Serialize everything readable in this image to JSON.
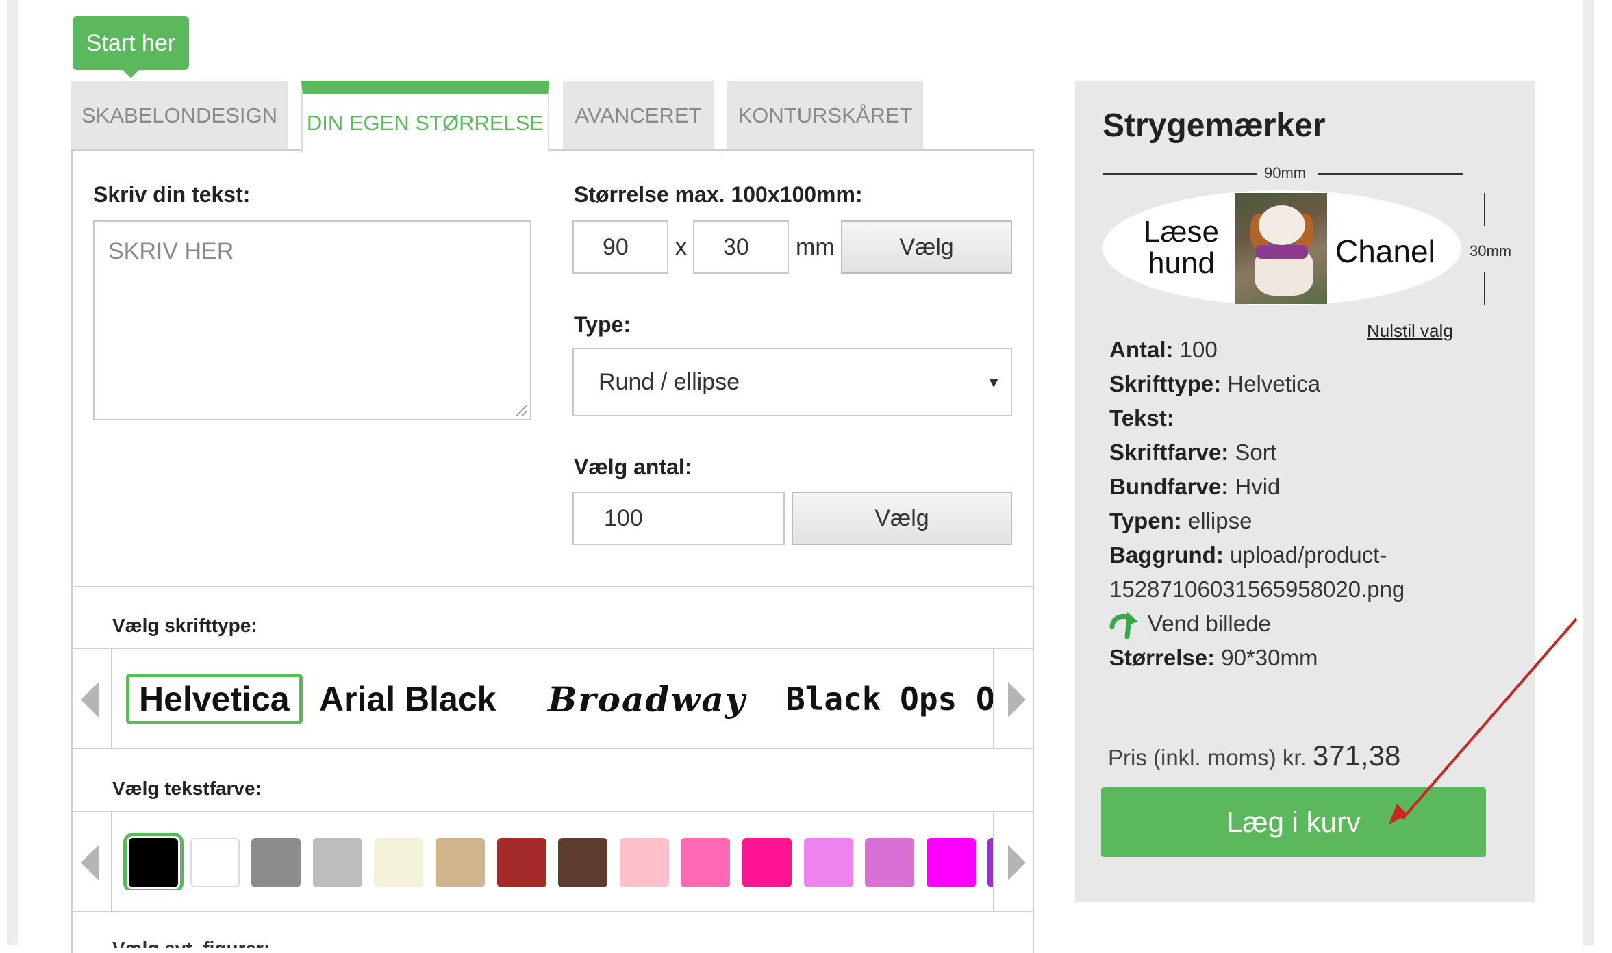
{
  "start_badge": "Start her",
  "tabs": [
    {
      "label": "SKABELONDESIGN"
    },
    {
      "label": "DIN EGEN STØRRELSE"
    },
    {
      "label": "AVANCERET"
    },
    {
      "label": "KONTURSKÅRET"
    }
  ],
  "text_section": {
    "label": "Skriv din tekst:",
    "placeholder": "SKRIV HER"
  },
  "size_section": {
    "label": "Størrelse max. 100x100mm:",
    "width": "90",
    "separator": "x",
    "height": "30",
    "unit": "mm",
    "button": "Vælg"
  },
  "type_section": {
    "label": "Type:",
    "selected": "Rund / ellipse"
  },
  "quantity_section": {
    "label": "Vælg antal:",
    "value": "100",
    "button": "Vælg"
  },
  "font_section": {
    "label": "Vælg skrifttype:",
    "fonts": [
      "Helvetica",
      "Arial Black",
      "Broadway",
      "Black Ops One"
    ],
    "selected_index": 0
  },
  "color_section": {
    "label": "Vælg tekstfarve:",
    "colors": [
      "#000000",
      "#ffffff",
      "#8c8c8c",
      "#bdbdbd",
      "#f5f2dc",
      "#d2b48c",
      "#a52a2a",
      "#5c3d2e",
      "#ffc0cb",
      "#ff69b4",
      "#ff1493",
      "#ee82ee",
      "#da70d6",
      "#ff00ff",
      "#9932cc"
    ],
    "selected_index": 0
  },
  "next_section_label": "Vælg evt. figurer:",
  "summary": {
    "title": "Strygemærker",
    "width_dim": "90mm",
    "height_dim": "30mm",
    "preview_left_text": "Læse hund",
    "preview_right_text": "Chanel",
    "reset_link": "Nulstil valg",
    "details": [
      {
        "key": "Antal:",
        "value": "100"
      },
      {
        "key": "Skrifttype:",
        "value": "Helvetica"
      },
      {
        "key": "Tekst:",
        "value": ""
      },
      {
        "key": "Skriftfarve:",
        "value": "Sort"
      },
      {
        "key": "Bundfarve:",
        "value": "Hvid"
      },
      {
        "key": "Typen:",
        "value": "ellipse"
      },
      {
        "key": "Baggrund:",
        "value": "upload/product-"
      }
    ],
    "bg_filename_cont": "15287106031565958020.png",
    "flip_label": "Vend billede",
    "size_key": "Størrelse:",
    "size_value": "90*30mm",
    "price_label": "Pris (inkl. moms) kr.",
    "price_amount": "371,38",
    "cart_button": "Læg i kurv"
  },
  "colors": {
    "accent": "#5cb85c",
    "panel_bg": "#e8e8e8",
    "annotation_arrow": "#c62828"
  }
}
